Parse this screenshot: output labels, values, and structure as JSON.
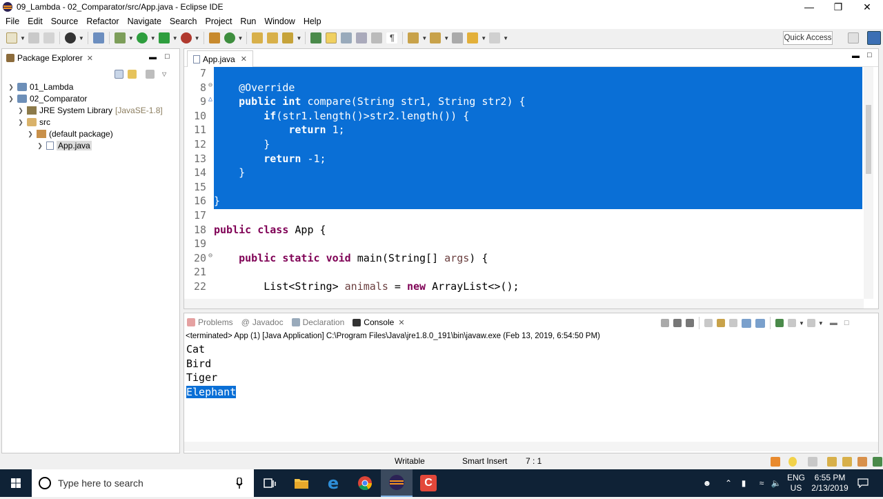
{
  "window": {
    "title": "09_Lambda - 02_Comparator/src/App.java - Eclipse IDE"
  },
  "menu": [
    "File",
    "Edit",
    "Source",
    "Refactor",
    "Navigate",
    "Search",
    "Project",
    "Run",
    "Window",
    "Help"
  ],
  "toolbar": {
    "quick_access": "Quick Access"
  },
  "package_explorer": {
    "tab_label": "Package Explorer",
    "tree": [
      {
        "label": "01_Lambda",
        "decoration": ""
      },
      {
        "label": "02_Comparator",
        "decoration": ""
      },
      {
        "label": "JRE System Library",
        "decoration": "[JavaSE-1.8]"
      },
      {
        "label": "src",
        "decoration": ""
      },
      {
        "label": "(default package)",
        "decoration": ""
      },
      {
        "label": "App.java",
        "decoration": ""
      }
    ]
  },
  "editor": {
    "tab_label": "App.java",
    "line_numbers": [
      "7",
      "8",
      "9",
      "10",
      "11",
      "12",
      "13",
      "14",
      "15",
      "16",
      "17",
      "18",
      "19",
      "20",
      "21",
      "22"
    ]
  },
  "console": {
    "tabs": [
      "Problems",
      "Javadoc",
      "Declaration",
      "Console"
    ],
    "header": "<terminated> App (1) [Java Application] C:\\Program Files\\Java\\jre1.8.0_191\\bin\\javaw.exe (Feb 13, 2019, 6:54:50 PM)",
    "output": [
      "Cat",
      "Bird",
      "Tiger",
      "Elephant"
    ]
  },
  "status": {
    "writable": "Writable",
    "insert_mode": "Smart Insert",
    "position": "7 : 1"
  },
  "taskbar": {
    "search_placeholder": "Type here to search",
    "lang": "ENG",
    "region": "US",
    "time": "6:55 PM",
    "date": "2/13/2019"
  },
  "colors": {
    "selection": "#0a6fd6",
    "keyword": "#7f0055",
    "annotation": "#646464",
    "taskbar": "#0f2236"
  }
}
